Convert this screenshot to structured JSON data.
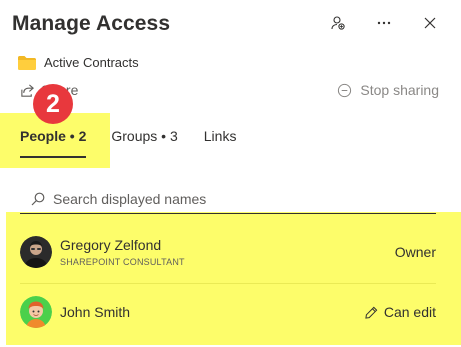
{
  "header": {
    "title": "Manage Access"
  },
  "folder": {
    "name": "Active Contracts"
  },
  "share": {
    "label": "Share"
  },
  "stop_sharing": {
    "label": "Stop sharing"
  },
  "annotation": {
    "step_number": "2",
    "highlight_color": "#fdfd6a",
    "badge_color": "#e8383d"
  },
  "tabs": [
    {
      "label": "People • 2",
      "selected": true
    },
    {
      "label": "Groups • 3",
      "selected": false
    },
    {
      "label": "Links",
      "selected": false
    }
  ],
  "search": {
    "placeholder": "Search displayed names"
  },
  "people": [
    {
      "name": "Gregory Zelfond",
      "title": "SHAREPOINT CONSULTANT",
      "role": "Owner"
    },
    {
      "name": "John Smith",
      "title": "",
      "role": "Can edit"
    }
  ]
}
